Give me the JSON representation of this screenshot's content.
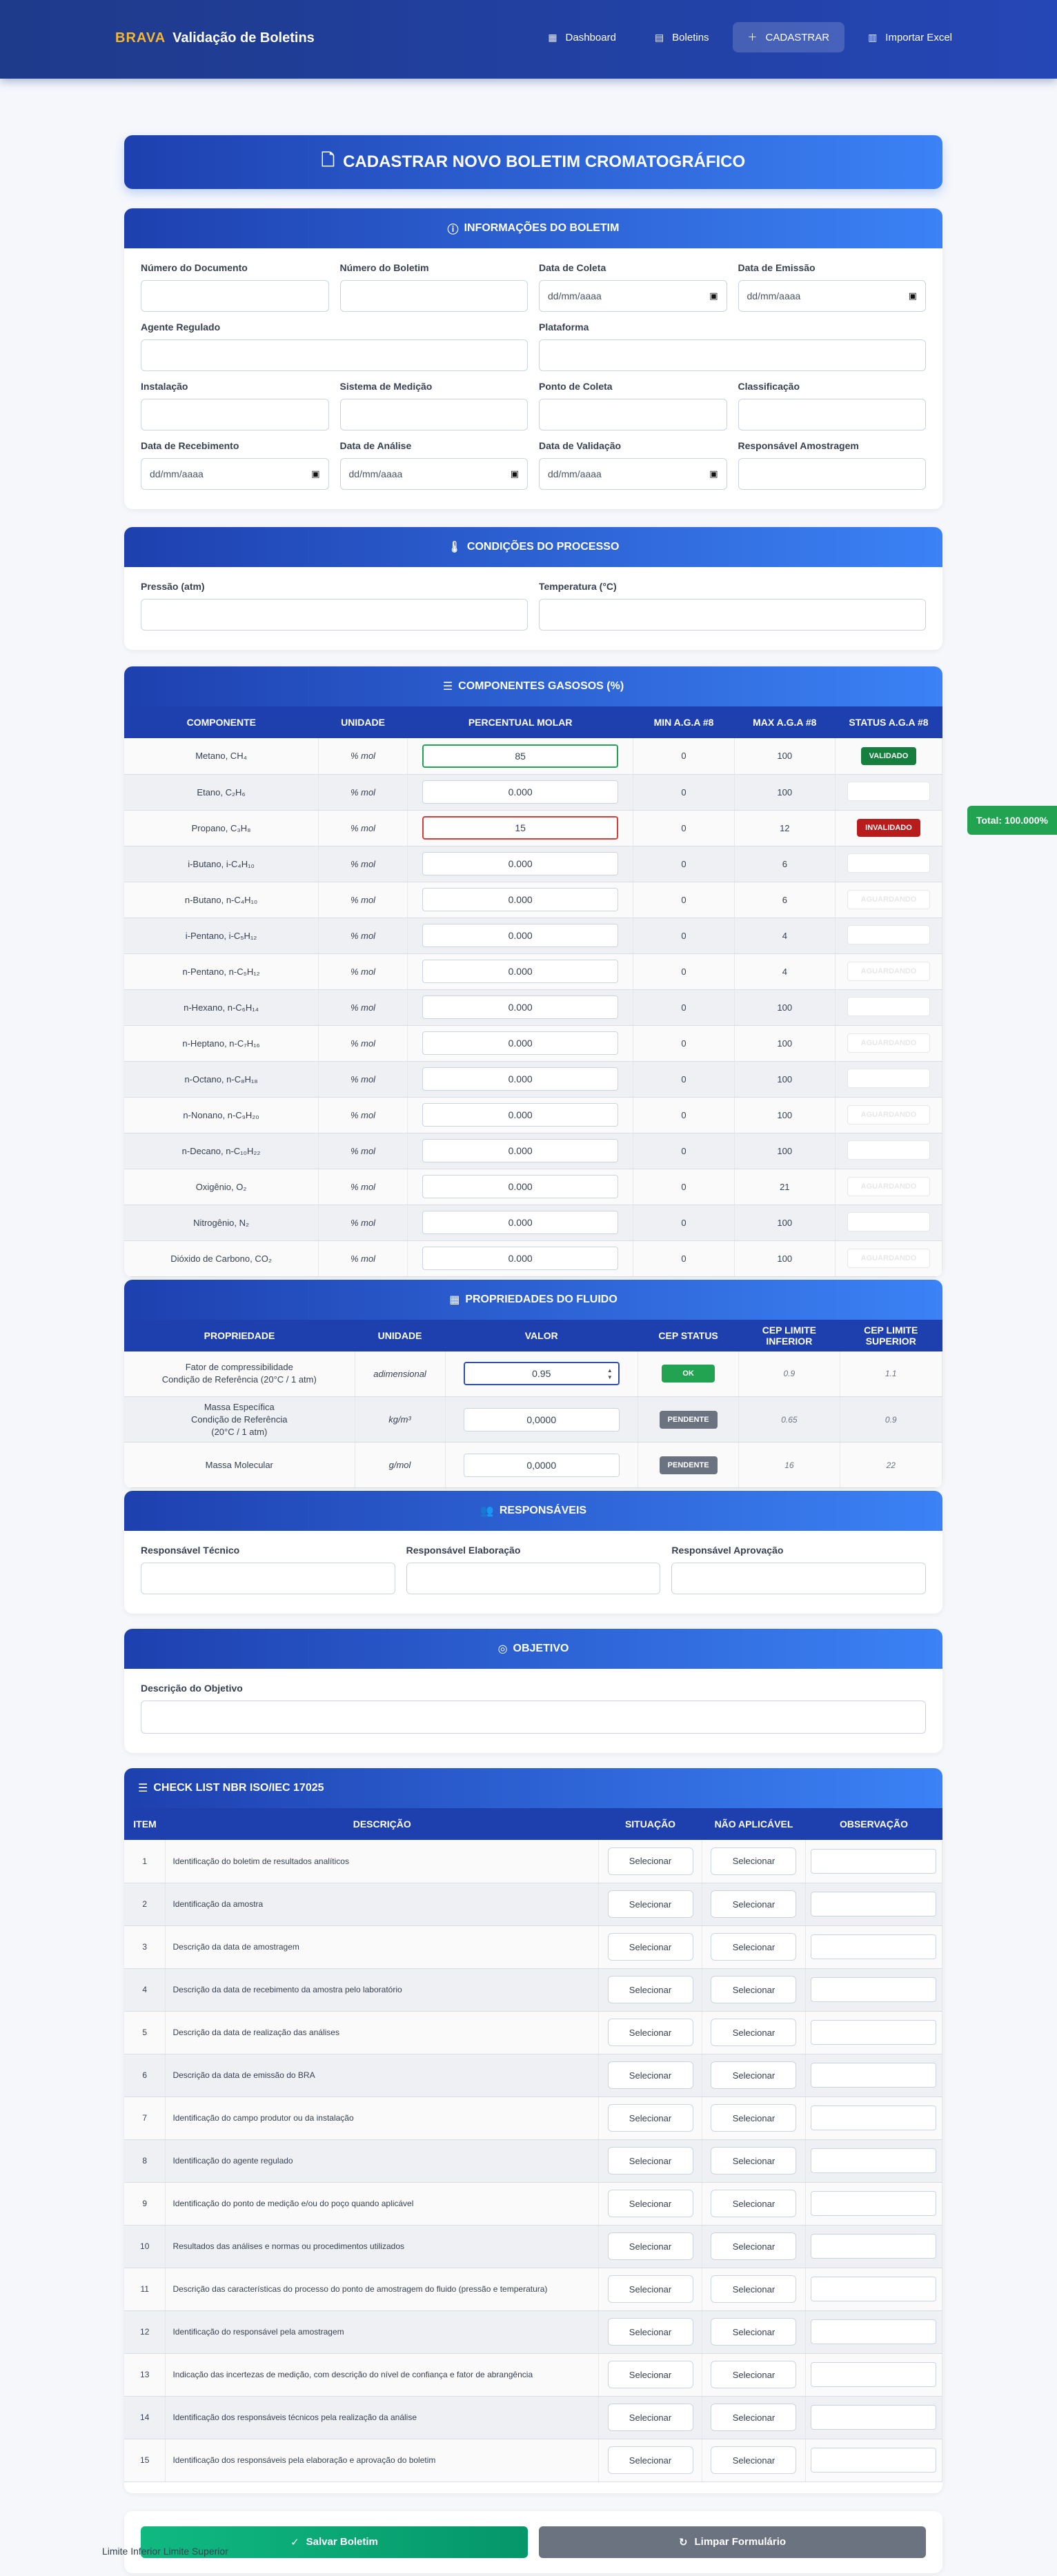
{
  "app": {
    "brand_accent": "BRAVA",
    "brand_title": "Validação de Boletins"
  },
  "nav": [
    {
      "label": "Dashboard",
      "icon": "chart-icon"
    },
    {
      "label": "Boletins",
      "icon": "document-icon"
    },
    {
      "label": "CADASTRAR",
      "icon": "plus-icon",
      "active": true
    },
    {
      "label": "Importar Excel",
      "icon": "spreadsheet-icon"
    }
  ],
  "hero": {
    "title": "CADASTRAR NOVO BOLETIM CROMATOGRÁFICO"
  },
  "info": {
    "title": "INFORMAÇÕES DO BOLETIM",
    "fields": {
      "numero_documento": "Número do Documento",
      "numero_boletim": "Número do Boletim",
      "data_coleta": "Data de Coleta",
      "data_emissao": "Data de Emissão",
      "agente_regulado": "Agente Regulado",
      "plataforma": "Plataforma",
      "instalacao": "Instalação",
      "sistema_medicao": "Sistema de Medição",
      "ponto_coleta": "Ponto de Coleta",
      "classificacao": "Classificação",
      "data_recebimento": "Data de Recebimento",
      "data_analise": "Data de Análise",
      "data_validacao": "Data de Validação",
      "responsavel_amostragem": "Responsável Amostragem"
    },
    "date_placeholder": "dd/mm/aaaa"
  },
  "processo": {
    "title": "CONDIÇÕES DO PROCESSO",
    "pressao": "Pressão (atm)",
    "temperatura": "Temperatura (°C)"
  },
  "componentes": {
    "title": "COMPONENTES GASOSOS (%)",
    "headers": [
      "COMPONENTE",
      "UNIDADE",
      "PERCENTUAL MOLAR",
      "MIN A.G.A #8",
      "MAX A.G.A #8",
      "STATUS A.G.A #8"
    ],
    "rows": [
      {
        "name": "Metano, CH₄",
        "unit": "% mol",
        "value": "85",
        "min": "0",
        "max": "100",
        "status": "VALIDADO",
        "state": "ok"
      },
      {
        "name": "Etano, C₂H₆",
        "unit": "% mol",
        "value": "0.000",
        "min": "0",
        "max": "100",
        "status": "",
        "state": "none"
      },
      {
        "name": "Propano, C₃H₈",
        "unit": "% mol",
        "value": "15",
        "min": "0",
        "max": "12",
        "status": "INVALIDADO",
        "state": "bad"
      },
      {
        "name": "i-Butano, i-C₄H₁₀",
        "unit": "% mol",
        "value": "0.000",
        "min": "0",
        "max": "6",
        "status": "",
        "state": "none"
      },
      {
        "name": "n-Butano, n-C₄H₁₀",
        "unit": "% mol",
        "value": "0.000",
        "min": "0",
        "max": "6",
        "status": "AGUARDANDO",
        "state": "ghost"
      },
      {
        "name": "i-Pentano, i-C₅H₁₂",
        "unit": "% mol",
        "value": "0.000",
        "min": "0",
        "max": "4",
        "status": "",
        "state": "none"
      },
      {
        "name": "n-Pentano, n-C₅H₁₂",
        "unit": "% mol",
        "value": "0.000",
        "min": "0",
        "max": "4",
        "status": "AGUARDANDO",
        "state": "ghost"
      },
      {
        "name": "n-Hexano, n-C₆H₁₄",
        "unit": "% mol",
        "value": "0.000",
        "min": "0",
        "max": "100",
        "status": "",
        "state": "none"
      },
      {
        "name": "n-Heptano, n-C₇H₁₆",
        "unit": "% mol",
        "value": "0.000",
        "min": "0",
        "max": "100",
        "status": "AGUARDANDO",
        "state": "ghost"
      },
      {
        "name": "n-Octano, n-C₈H₁₈",
        "unit": "% mol",
        "value": "0.000",
        "min": "0",
        "max": "100",
        "status": "",
        "state": "none"
      },
      {
        "name": "n-Nonano, n-C₉H₂₀",
        "unit": "% mol",
        "value": "0.000",
        "min": "0",
        "max": "100",
        "status": "AGUARDANDO",
        "state": "ghost"
      },
      {
        "name": "n-Decano, n-C₁₀H₂₂",
        "unit": "% mol",
        "value": "0.000",
        "min": "0",
        "max": "100",
        "status": "",
        "state": "none"
      },
      {
        "name": "Oxigênio, O₂",
        "unit": "% mol",
        "value": "0.000",
        "min": "0",
        "max": "21",
        "status": "AGUARDANDO",
        "state": "ghost"
      },
      {
        "name": "Nitrogênio, N₂",
        "unit": "% mol",
        "value": "0.000",
        "min": "0",
        "max": "100",
        "status": "",
        "state": "none"
      },
      {
        "name": "Dióxido de Carbono, CO₂",
        "unit": "% mol",
        "value": "0.000",
        "min": "0",
        "max": "100",
        "status": "AGUARDANDO",
        "state": "ghost"
      }
    ],
    "total": "Total: 100.000%"
  },
  "fluido": {
    "title": "PROPRIEDADES DO FLUIDO",
    "headers": [
      "PROPRIEDADE",
      "UNIDADE",
      "VALOR",
      "CEP STATUS",
      "CEP LIMITE INFERIOR",
      "CEP LIMITE SUPERIOR"
    ],
    "rows": [
      {
        "name": "Fator de compressibilidade\nCondição de Referência (20°C / 1 atm)",
        "unit": "adimensional",
        "value": "0.95",
        "status": "OK",
        "lim_inf": "0.9",
        "lim_sup": "1.1",
        "state": "ok"
      },
      {
        "name": "Massa Específica\nCondição de Referência\n(20°C / 1 atm)",
        "unit": "kg/m³",
        "value": "0,0000",
        "status": "PENDENTE",
        "lim_inf": "0.65",
        "lim_sup": "0.9",
        "state": "pend"
      },
      {
        "name": "Massa Molecular",
        "unit": "g/mol",
        "value": "0,0000",
        "status": "PENDENTE",
        "lim_inf": "16",
        "lim_sup": "22",
        "state": "pend"
      }
    ]
  },
  "responsaveis": {
    "title": "RESPONSÁVEIS",
    "tecnico": "Responsável Técnico",
    "elaboracao": "Responsável Elaboração",
    "aprovacao": "Responsável Aprovação"
  },
  "objetivo": {
    "title": "OBJETIVO",
    "label": "Descrição do Objetivo"
  },
  "checklist": {
    "title": "CHECK LIST NBR ISO/IEC 17025",
    "headers": [
      "ITEM",
      "DESCRIÇÃO",
      "SITUAÇÃO",
      "NÃO APLICÁVEL",
      "OBSERVAÇÃO"
    ],
    "select_label": "Selecionar",
    "rows": [
      "Identificação do boletim de resultados analíticos",
      "Identificação da amostra",
      "Descrição da data de amostragem",
      "Descrição da data de recebimento da amostra pelo laboratório",
      "Descrição da data de realização das análises",
      "Descrição da data de emissão do BRA",
      "Identificação do campo produtor ou da instalação",
      "Identificação do agente regulado",
      "Identificação do ponto de medição e/ou do poço quando aplicável",
      "Resultados das análises e normas ou procedimentos utilizados",
      "Descrição das características do processo do ponto de amostragem do fluido (pressão e temperatura)",
      "Identificação do responsável pela amostragem",
      "Indicação das incertezas de medição, com descrição do nível de confiança e fator de abrangência",
      "Identificação dos responsáveis técnicos pela realização da análise",
      "Identificação dos responsáveis pela elaboração e aprovação do boletim"
    ]
  },
  "actions": {
    "save": "Salvar Boletim",
    "clear": "Limpar Formulário"
  },
  "footer": {
    "legend": "Limite Inferior Limite Superior"
  },
  "colors": {
    "primary": "#1e40af",
    "accent": "#f5b731",
    "success": "#22a352",
    "danger": "#b91c1c",
    "pending": "#6b7280"
  }
}
